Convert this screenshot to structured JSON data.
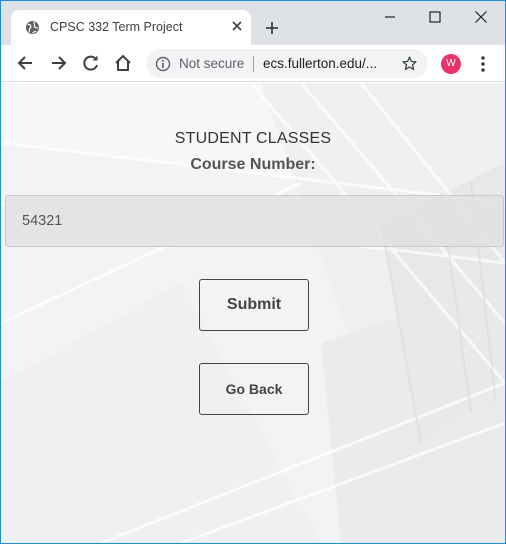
{
  "browser": {
    "tab_title": "CPSC 332 Term Project",
    "security_label": "Not secure",
    "url": "ecs.fullerton.edu/...",
    "profile_initial": "W",
    "profile_color": "#e8336b"
  },
  "page": {
    "title": "STUDENT CLASSES",
    "subtitle": "Course Number:",
    "course_input_value": "54321",
    "submit_label": "Submit",
    "back_label": "Go Back"
  },
  "icons": [
    "globe-icon",
    "close-icon",
    "plus-icon",
    "minimize-icon",
    "maximize-icon",
    "close-window-icon",
    "back-arrow-icon",
    "forward-arrow-icon",
    "reload-icon",
    "home-icon",
    "info-icon",
    "star-icon",
    "menu-icon"
  ]
}
